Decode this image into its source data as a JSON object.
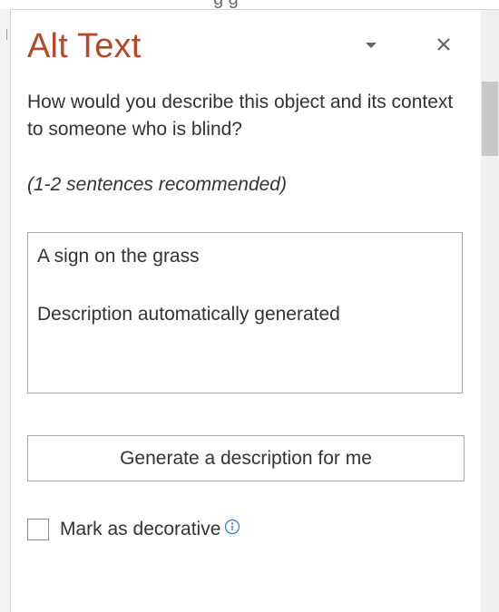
{
  "pane": {
    "title": "Alt Text",
    "question": "How would you describe this object and its context to someone who is blind?",
    "hint": "(1-2 sentences recommended)",
    "description": {
      "line1": "A sign on the grass",
      "line2": "Description automatically generated"
    },
    "generate_button": "Generate a description for me",
    "decorative_label": "Mark as decorative",
    "decorative_checked": false
  },
  "icons": {
    "dropdown": "chevron-down-icon",
    "close": "close-icon",
    "info": "info-icon"
  },
  "colors": {
    "title": "#b7472a",
    "text": "#333333",
    "info_icon": "#2b7cd3"
  }
}
